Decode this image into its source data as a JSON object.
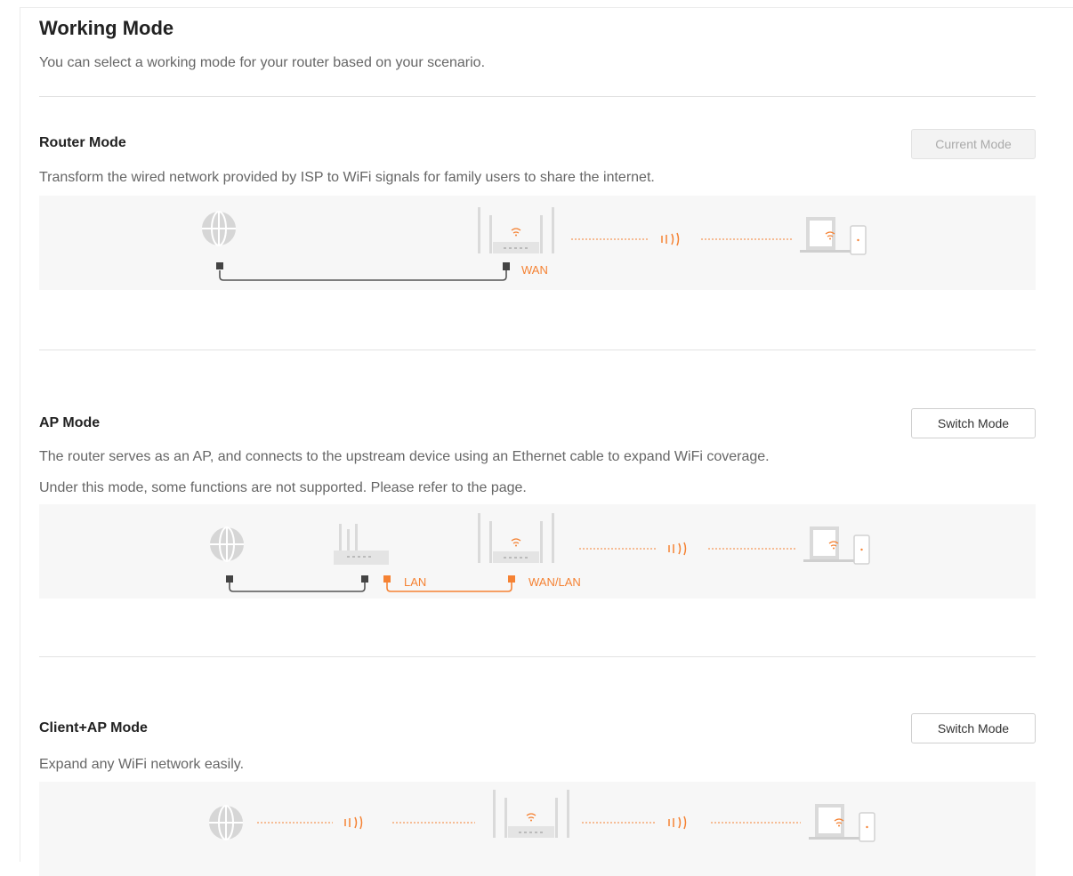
{
  "page": {
    "title": "Working Mode",
    "subtitle": "You can select a working mode for your router based on your scenario."
  },
  "modes": {
    "router": {
      "title": "Router Mode",
      "button": "Current Mode",
      "desc": "Transform the wired network provided by ISP to WiFi signals for family users to share the internet.",
      "labels": {
        "wan": "WAN"
      }
    },
    "ap": {
      "title": "AP Mode",
      "button": "Switch Mode",
      "desc_line1": "The router serves as an AP, and connects to the upstream device using an Ethernet cable to expand WiFi coverage.",
      "desc_line2": "Under this mode, some functions are not supported. Please refer to the page.",
      "labels": {
        "lan": "LAN",
        "wan_lan": "WAN/LAN"
      }
    },
    "client_ap": {
      "title": "Client+AP Mode",
      "button": "Switch Mode",
      "desc": "Expand any WiFi network easily."
    }
  },
  "icons": [
    "globe-icon",
    "router-icon",
    "ethernet-port-icon",
    "wifi-waves-icon",
    "laptop-icon",
    "phone-icon"
  ],
  "colors": {
    "accent": "#f58233",
    "cable": "#555555",
    "diagram_bg": "#f7f7f7",
    "icon_gray": "#d6d6d6"
  }
}
